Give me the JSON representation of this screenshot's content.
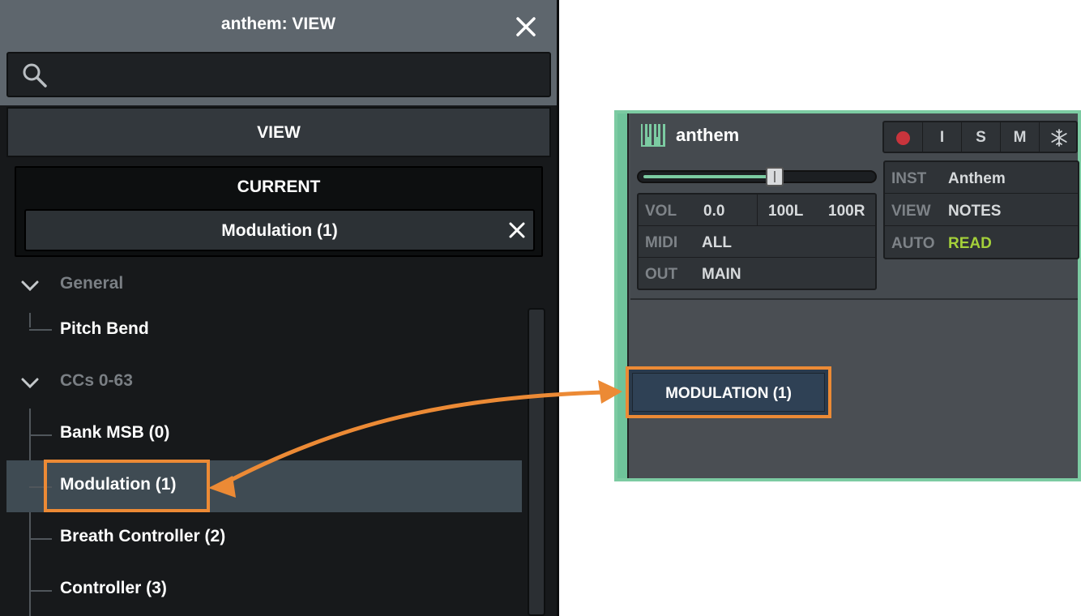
{
  "panel": {
    "title": "anthem: VIEW",
    "search_placeholder": "",
    "view_label": "VIEW",
    "current_label": "CURRENT",
    "current_value": "Modulation (1)"
  },
  "tree": {
    "groups": [
      {
        "label": "General",
        "items": [
          "Pitch Bend"
        ]
      },
      {
        "label": "CCs 0-63",
        "items": [
          "Bank MSB (0)",
          "Modulation (1)",
          "Breath Controller (2)",
          "Controller (3)"
        ]
      }
    ],
    "selected": "Modulation (1)"
  },
  "track": {
    "name": "anthem",
    "buttons": {
      "input": "I",
      "solo": "S",
      "mute": "M"
    },
    "volume_slider_position": 0.58,
    "vol_key": "VOL",
    "vol_value": "0.0",
    "pan_left": "100L",
    "pan_right": "100R",
    "midi_key": "MIDI",
    "midi_value": "ALL",
    "out_key": "OUT",
    "out_value": "MAIN",
    "inst_key": "INST",
    "inst_value": "Anthem",
    "view_key": "VIEW",
    "view_value": "NOTES",
    "auto_key": "AUTO",
    "auto_value": "READ",
    "lane_label": "MODULATION (1)"
  },
  "colors": {
    "accent_green": "#7ccba2",
    "highlight_orange": "#ec8a35",
    "auto_read": "#a4d03a",
    "record_red": "#c8343c"
  }
}
